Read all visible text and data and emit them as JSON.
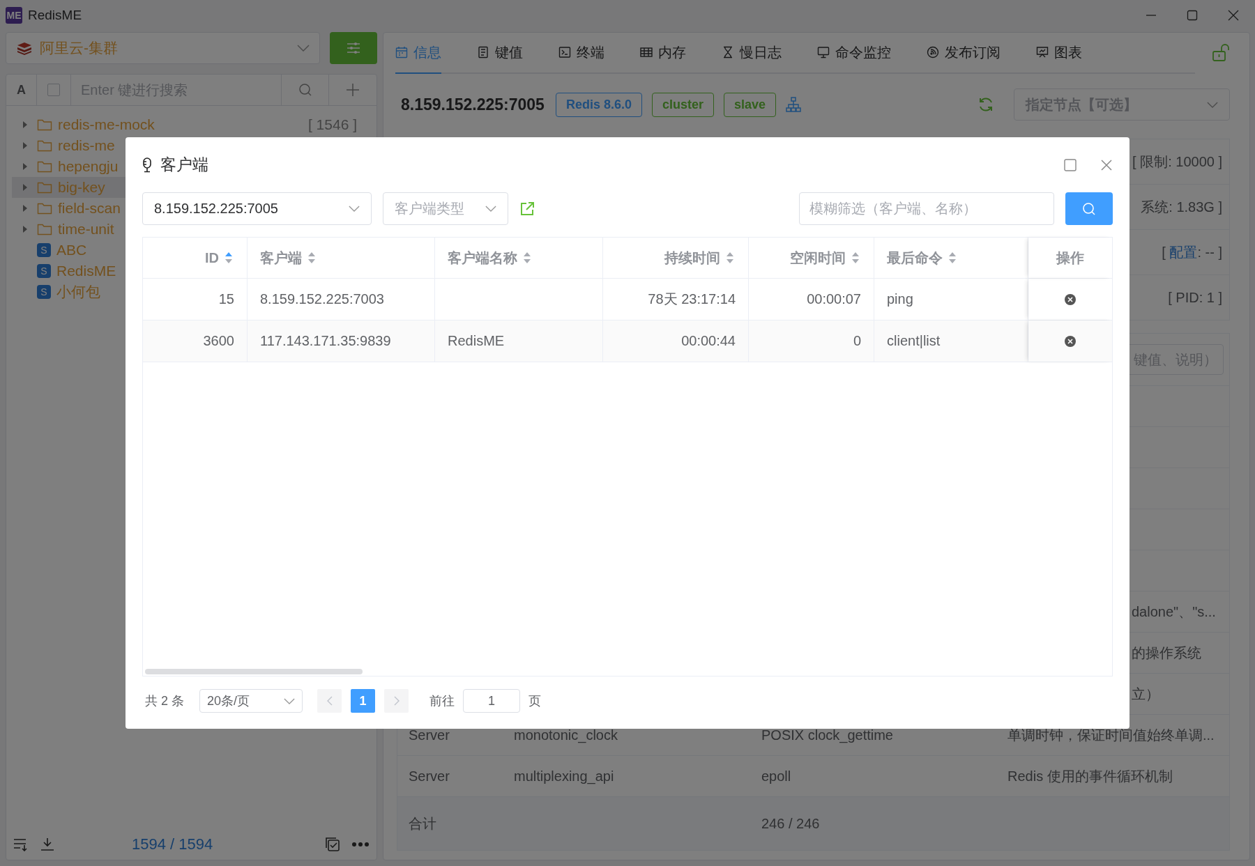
{
  "app": {
    "logo": "ME",
    "title": "RedisME"
  },
  "sidebar": {
    "connection": "阿里云-集群",
    "case_toggle": "A",
    "select_all": {
      "checked": false
    },
    "search": {
      "placeholder": "Enter 键进行搜索"
    },
    "tree": [
      {
        "kind": "folder",
        "label": "redis-me-mock",
        "count": "[ 1546 ]",
        "selected": false
      },
      {
        "kind": "folder",
        "label": "redis-me",
        "selected": false
      },
      {
        "kind": "folder",
        "label": "hepengju",
        "selected": false
      },
      {
        "kind": "folder",
        "label": "big-key",
        "selected": true
      },
      {
        "kind": "folder",
        "label": "field-scan",
        "selected": false
      },
      {
        "kind": "folder",
        "label": "time-unit",
        "selected": false
      },
      {
        "kind": "key",
        "badge": "S",
        "label": "ABC",
        "selected": false
      },
      {
        "kind": "key",
        "badge": "S",
        "label": "RedisME",
        "selected": false
      },
      {
        "kind": "key",
        "badge": "S",
        "label": "小何包",
        "selected": false
      }
    ],
    "footer": {
      "count": "1594 / 1594"
    }
  },
  "main": {
    "tabs": [
      {
        "label": "信息",
        "selected": true
      },
      {
        "label": "键值",
        "selected": false
      },
      {
        "label": "终端",
        "selected": false
      },
      {
        "label": "内存",
        "selected": false
      },
      {
        "label": "慢日志",
        "selected": false
      },
      {
        "label": "命令监控",
        "selected": false
      },
      {
        "label": "发布订阅",
        "selected": false
      },
      {
        "label": "图表",
        "selected": false
      }
    ],
    "server": {
      "address": "8.159.152.225:7005",
      "tags": [
        {
          "label": "Redis 8.6.0",
          "kind": "version"
        },
        {
          "label": "cluster",
          "kind": "mode"
        },
        {
          "label": "slave",
          "kind": "role"
        }
      ]
    },
    "node_select": {
      "placeholder": "指定节点【可选】"
    },
    "info_rows": [
      {
        "text": "[ 限制: 10000 ]"
      },
      {
        "text": "系统: 1.83G ]"
      },
      {
        "before": "[ ",
        "link": "配置",
        "after": ": -- ]"
      },
      {
        "text": "[ PID: 1 ]"
      }
    ],
    "config_search": {
      "placeholder": "键值、说明）"
    },
    "config_rows": [
      {
        "kind": "partial",
        "text": "dalone\"、\"s..."
      },
      {
        "kind": "partial",
        "text": "的操作系统"
      },
      {
        "kind": "partial",
        "text": "立）"
      },
      {
        "kind": "full",
        "cells": [
          "Server",
          "monotonic_clock",
          "POSIX clock_gettime",
          "单调时钟，保证时间值始终单调..."
        ]
      },
      {
        "kind": "full",
        "cells": [
          "Server",
          "multiplexing_api",
          "epoll",
          "Redis 使用的事件循环机制"
        ]
      }
    ],
    "total": {
      "label": "合计",
      "value": "246 / 246"
    }
  },
  "dialog": {
    "title": "客户端",
    "node": "8.159.152.225:7005",
    "client_type": {
      "placeholder": "客户端类型"
    },
    "filter": {
      "placeholder": "模糊筛选（客户端、名称）"
    },
    "table": {
      "columns": [
        {
          "label": "ID",
          "kind": "sortable",
          "sorted": true
        },
        {
          "label": "客户端",
          "kind": "sortable",
          "sorted": false
        },
        {
          "label": "客户端名称",
          "kind": "sortable",
          "sorted": false
        },
        {
          "label": "持续时间",
          "kind": "sortable",
          "sorted": false
        },
        {
          "label": "空闲时间",
          "kind": "sortable",
          "sorted": false
        },
        {
          "label": "最后命令",
          "kind": "sortable",
          "sorted": false
        },
        {
          "label": "操作",
          "kind": "plain"
        }
      ],
      "rows": [
        {
          "id": "15",
          "client": "8.159.152.225:7003",
          "duration": "78天 23:17:14",
          "idle": "00:00:07",
          "last_command": "ping"
        },
        {
          "id": "3600",
          "client": "117.143.171.35:9839",
          "name": "RedisME",
          "duration": "00:00:44",
          "idle": "0",
          "last_command": "client|list"
        }
      ]
    },
    "pagination": {
      "total": "共 2 条",
      "page_size": "20条/页",
      "prev_disabled": true,
      "next_disabled": true,
      "pages": [
        {
          "label": "1",
          "selected": true
        }
      ],
      "goto_label": "前往",
      "goto_value": "1",
      "goto_suffix": "页"
    }
  }
}
